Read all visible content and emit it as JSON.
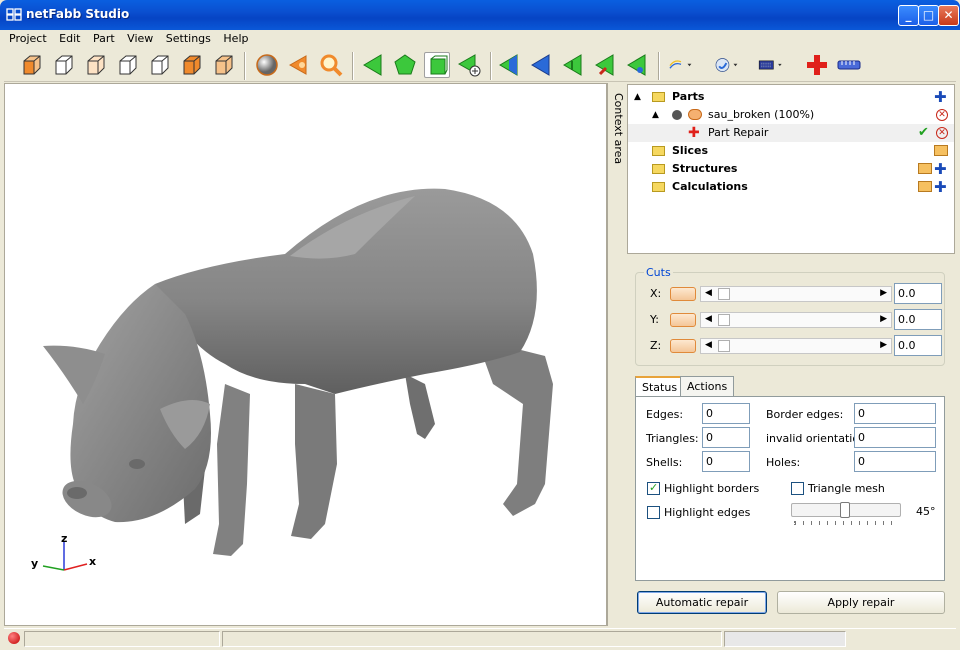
{
  "window": {
    "title": "netFabb Studio"
  },
  "menu": [
    "Project",
    "Edit",
    "Part",
    "View",
    "Settings",
    "Help"
  ],
  "context_area_label": "Context area",
  "tree": {
    "parts": "Parts",
    "part_name": "sau_broken (100%)",
    "part_repair": "Part Repair",
    "slices": "Slices",
    "structures": "Structures",
    "calculations": "Calculations"
  },
  "cuts": {
    "label": "Cuts",
    "x_label": "X:",
    "y_label": "Y:",
    "z_label": "Z:",
    "x_value": "0.0",
    "y_value": "0.0",
    "z_value": "0.0"
  },
  "tabs": {
    "status": "Status",
    "actions": "Actions"
  },
  "status": {
    "edges_label": "Edges:",
    "edges": "0",
    "triangles_label": "Triangles:",
    "triangles": "0",
    "shells_label": "Shells:",
    "shells": "0",
    "border_edges_label": "Border edges:",
    "border_edges": "0",
    "invalid_orientation_label": "invalid orientation:",
    "invalid_orientation": "0",
    "holes_label": "Holes:",
    "holes": "0",
    "highlight_borders": "Highlight borders",
    "highlight_borders_checked": true,
    "triangle_mesh": "Triangle mesh",
    "triangle_mesh_checked": false,
    "highlight_edges": "Highlight edges",
    "highlight_edges_checked": false,
    "angle": "45°"
  },
  "buttons": {
    "automatic_repair": "Automatic repair",
    "apply_repair": "Apply repair"
  },
  "axes": {
    "z": "z",
    "y": "y",
    "x": "x"
  },
  "colors": {
    "accent": "#0046d5",
    "title_bar": "#0a58d8",
    "model": "#8a8a8a"
  }
}
